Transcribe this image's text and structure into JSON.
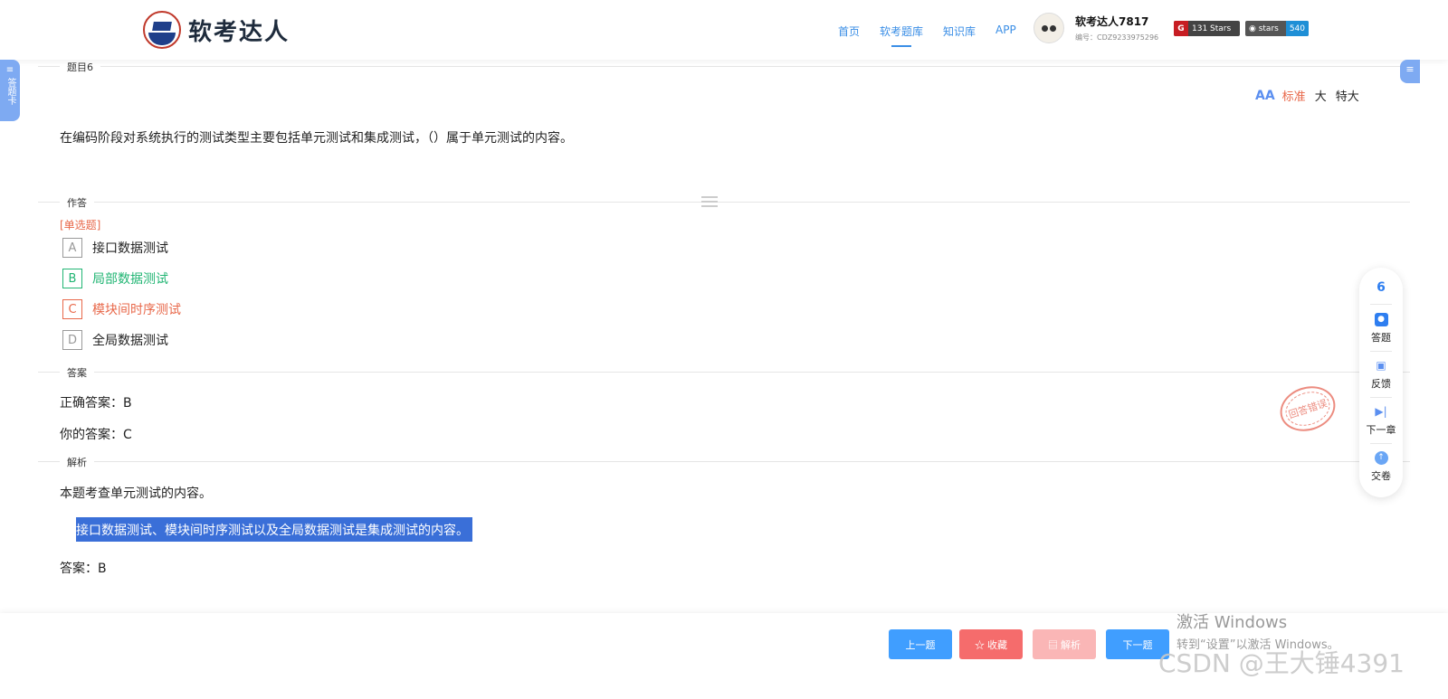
{
  "header": {
    "logo_text": "软考达人",
    "nav": [
      {
        "label": "首页"
      },
      {
        "label": "软考题库",
        "active": true
      },
      {
        "label": "知识库"
      },
      {
        "label": "APP"
      }
    ],
    "user_name": "软考达人7817",
    "user_id": "编号：CDZ9233975296",
    "gitee_badge": "131 Stars",
    "github_badge_label": "stars",
    "github_badge_count": "540"
  },
  "side_tab_left": "答题卡",
  "question": {
    "section_label": "题目6",
    "text": "在编码阶段对系统执行的测试类型主要包括单元测试和集成测试，（）属于单元测试的内容。",
    "font_sizes": [
      "标准",
      "大",
      "特大"
    ]
  },
  "answer_section": {
    "label": "作答",
    "question_type": "[单选题]",
    "options": [
      {
        "key": "A",
        "text": "接口数据测试",
        "state": "normal"
      },
      {
        "key": "B",
        "text": "局部数据测试",
        "state": "correct"
      },
      {
        "key": "C",
        "text": "模块间时序测试",
        "state": "wrong"
      },
      {
        "key": "D",
        "text": "全局数据测试",
        "state": "normal"
      }
    ]
  },
  "result": {
    "label": "答案",
    "correct_answer": "正确答案：B",
    "your_answer": "你的答案：C",
    "stamp": "回答错误"
  },
  "explanation": {
    "label": "解析",
    "line1": "本题考查单元测试的内容。",
    "highlight": "接口数据测试、模块间时序测试以及全局数据测试是集成测试的内容。",
    "answer": "答案：B"
  },
  "float_panel": {
    "number": "6",
    "items": [
      "答题",
      "反馈",
      "下一章",
      "交卷"
    ]
  },
  "footer": {
    "prev": "上一题",
    "favorite": "☆ 收藏",
    "explain": "▤ 解析",
    "next": "下一题"
  },
  "watermark": {
    "line1": "激活 Windows",
    "line2": "转到“设置”以激活 Windows。",
    "csdn": "CSDN @王大锤4391"
  },
  "colors": {
    "primary": "#409eff",
    "correct": "#21b573",
    "wrong": "#e8684a"
  }
}
